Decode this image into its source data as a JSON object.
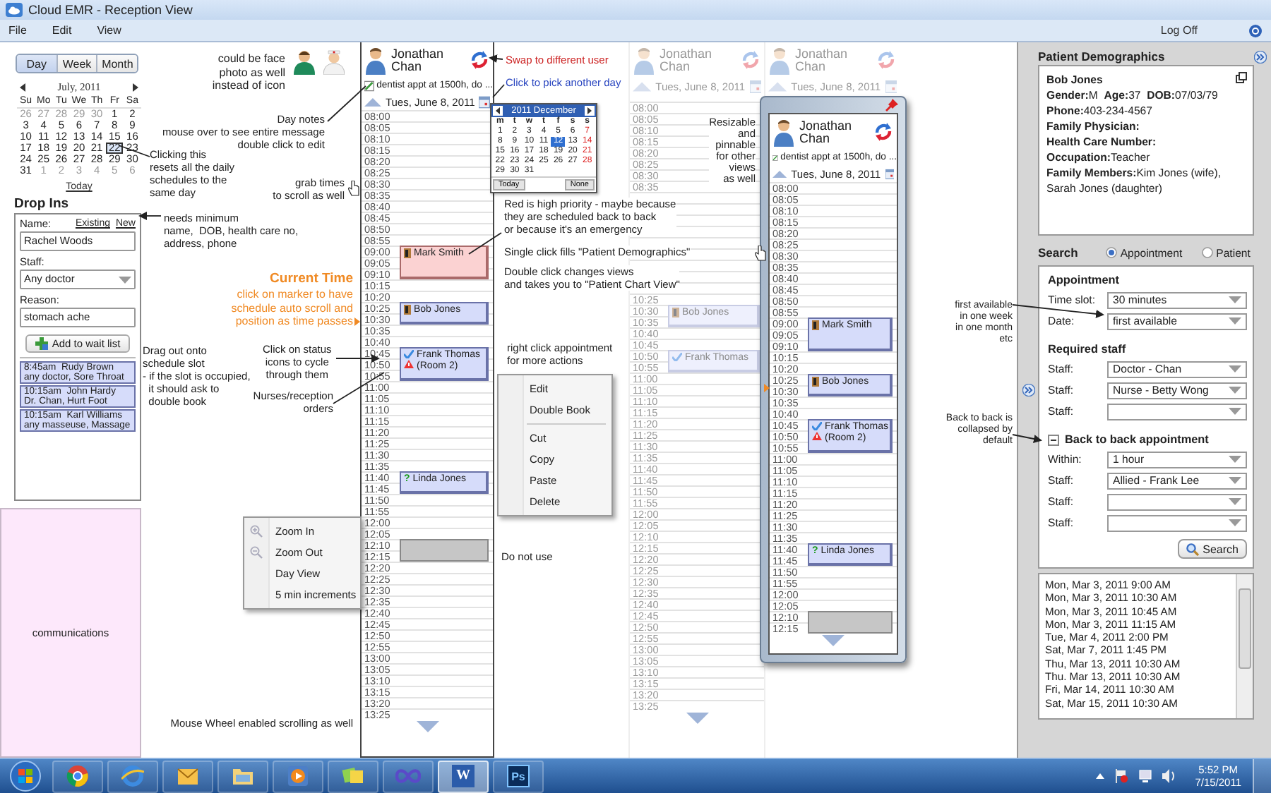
{
  "window": {
    "title": "Cloud EMR - Reception View"
  },
  "menu": [
    "File",
    "Edit",
    "View"
  ],
  "log_off": "Log Off",
  "view_switch": [
    {
      "label": "Day",
      "selected": true
    },
    {
      "label": "Week",
      "selected": false
    },
    {
      "label": "Month",
      "selected": false
    }
  ],
  "mini_calendar": {
    "title": "July, 2011",
    "weekdays": [
      "Su",
      "Mo",
      "Tu",
      "We",
      "Th",
      "Fr",
      "Sa"
    ],
    "weeks": [
      [
        {
          "day": "26",
          "outside": true,
          "selected": false
        },
        {
          "day": "27",
          "outside": true,
          "selected": false
        },
        {
          "day": "28",
          "outside": true,
          "selected": false
        },
        {
          "day": "29",
          "outside": true,
          "selected": false
        },
        {
          "day": "30",
          "outside": true,
          "selected": false
        },
        {
          "day": "1",
          "outside": false,
          "selected": false
        },
        {
          "day": "2",
          "outside": false,
          "selected": false
        }
      ],
      [
        {
          "day": "3",
          "outside": false,
          "selected": false
        },
        {
          "day": "4",
          "outside": false,
          "selected": false
        },
        {
          "day": "5",
          "outside": false,
          "selected": false
        },
        {
          "day": "6",
          "outside": false,
          "selected": false
        },
        {
          "day": "7",
          "outside": false,
          "selected": false
        },
        {
          "day": "8",
          "outside": false,
          "selected": false
        },
        {
          "day": "9",
          "outside": false,
          "selected": false
        }
      ],
      [
        {
          "day": "10",
          "outside": false,
          "selected": false
        },
        {
          "day": "11",
          "outside": false,
          "selected": false
        },
        {
          "day": "12",
          "outside": false,
          "selected": false
        },
        {
          "day": "13",
          "outside": false,
          "selected": false
        },
        {
          "day": "14",
          "outside": false,
          "selected": false
        },
        {
          "day": "15",
          "outside": false,
          "selected": false
        },
        {
          "day": "16",
          "outside": false,
          "selected": false
        }
      ],
      [
        {
          "day": "17",
          "outside": false,
          "selected": false
        },
        {
          "day": "18",
          "outside": false,
          "selected": false
        },
        {
          "day": "19",
          "outside": false,
          "selected": false
        },
        {
          "day": "20",
          "outside": false,
          "selected": false
        },
        {
          "day": "21",
          "outside": false,
          "selected": false
        },
        {
          "day": "22",
          "outside": false,
          "selected": true
        },
        {
          "day": "23",
          "outside": false,
          "selected": false
        }
      ],
      [
        {
          "day": "24",
          "outside": false,
          "selected": false
        },
        {
          "day": "25",
          "outside": false,
          "selected": false
        },
        {
          "day": "26",
          "outside": false,
          "selected": false
        },
        {
          "day": "27",
          "outside": false,
          "selected": false
        },
        {
          "day": "28",
          "outside": false,
          "selected": false
        },
        {
          "day": "29",
          "outside": false,
          "selected": false
        },
        {
          "day": "30",
          "outside": false,
          "selected": false
        }
      ],
      [
        {
          "day": "31",
          "outside": false,
          "selected": false
        },
        {
          "day": "1",
          "outside": true,
          "selected": false
        },
        {
          "day": "2",
          "outside": true,
          "selected": false
        },
        {
          "day": "3",
          "outside": true,
          "selected": false
        },
        {
          "day": "4",
          "outside": true,
          "selected": false
        },
        {
          "day": "5",
          "outside": true,
          "selected": false
        },
        {
          "day": "6",
          "outside": true,
          "selected": false
        }
      ]
    ],
    "today_link": "Today"
  },
  "drop_ins": {
    "title": "Drop Ins",
    "name_label": "Name:",
    "links": [
      "Existing",
      "New"
    ],
    "name_value": "Rachel Woods",
    "staff_label": "Staff:",
    "staff_value": "Any doctor",
    "reason_label": "Reason:",
    "reason_value": "stomach ache",
    "add_button": "Add to wait list",
    "waiting": [
      {
        "time": "8:45am",
        "name": "Rudy Brown",
        "detail": "any doctor, Sore Throat"
      },
      {
        "time": "10:15am",
        "name": "John Hardy",
        "detail": "Dr. Chan, Hurt Foot"
      },
      {
        "time": "10:15am",
        "name": "Karl Williams",
        "detail": "any masseuse, Massage"
      }
    ]
  },
  "communications": "communications",
  "schedule": {
    "columns": [
      {
        "faded": false,
        "user": "Jonathan Chan",
        "note": "dentist appt at 1500h, do ...",
        "date": "Tues, June 8, 2011",
        "slots": [
          "08:00",
          "08:05",
          "08:10",
          "08:15",
          "08:20",
          "08:25",
          "08:30",
          "08:35",
          "08:40",
          "08:45",
          "08:50",
          "08:55",
          {
            "times": [
              "09:00",
              "09:05",
              "09:10"
            ],
            "appointment": {
              "name": "Mark Smith",
              "kind": "high",
              "status": [
                {
                  "kind": "chart"
                }
              ]
            }
          },
          "10:15",
          "10:20",
          {
            "times": [
              "10:25",
              "10:30"
            ],
            "appointment": {
              "name": "Bob Jones",
              "kind": "normal",
              "status": [
                {
                  "kind": "chart"
                }
              ]
            }
          },
          "10:35",
          "10:40",
          {
            "times": [
              "10:45",
              "10:50",
              "10:55"
            ],
            "appointment": {
              "name": "Frank Thomas",
              "note": "(Room 2)",
              "kind": "normal",
              "status": [
                {
                  "kind": "check"
                },
                {
                  "kind": "warning"
                }
              ]
            }
          },
          "11:00",
          "11:05",
          "11:10",
          "11:15",
          "11:20",
          "11:25",
          "11:30",
          "11:35",
          {
            "times": [
              "11:40",
              "11:45"
            ],
            "appointment": {
              "name": "Linda Jones",
              "kind": "normal",
              "status": [
                {
                  "kind": "glyph",
                  "text": "?"
                }
              ]
            }
          },
          "11:50",
          "11:55",
          "12:00",
          "12:05",
          {
            "times": [
              "12:10",
              "12:15"
            ],
            "appointment": {
              "kind": "blocked"
            }
          },
          "12:20",
          "12:25",
          "12:30",
          "12:35",
          "12:40",
          "12:45",
          "12:50",
          "12:55",
          "13:00",
          "13:05",
          "13:10",
          "13:15",
          "13:20",
          "13:25"
        ]
      },
      {
        "faded": true,
        "user": "Jonathan Chan",
        "date": "Tues, June 8, 2011",
        "slots": [
          "08:00",
          "08:05",
          "08:10",
          "08:15",
          "08:20",
          "08:25",
          "08:30",
          "08:35",
          {
            "kind": "blank"
          },
          {
            "kind": "blank"
          },
          {
            "kind": "blank"
          },
          {
            "kind": "blank"
          },
          {
            "kind": "blank"
          },
          {
            "kind": "blank"
          },
          {
            "kind": "blank"
          },
          {
            "kind": "blank"
          },
          {
            "kind": "blank"
          },
          "10:25",
          {
            "times": [
              "10:30",
              "10:35"
            ],
            "appointment": {
              "name": "Bob Jones",
              "kind": "normal",
              "status": [
                {
                  "kind": "chart"
                }
              ]
            }
          },
          "10:40",
          "10:45",
          {
            "times": [
              "10:50",
              "10:55"
            ],
            "appointment": {
              "name": "Frank Thomas",
              "kind": "normal",
              "status": [
                {
                  "kind": "check"
                }
              ]
            }
          },
          "11:00",
          "11:05",
          "11:10",
          "11:15",
          "11:20",
          "11:25",
          "11:30",
          "11:35",
          "11:40",
          "11:45",
          "11:50",
          "11:55",
          "12:00",
          "12:05",
          "12:10",
          "12:15",
          "12:20",
          "12:25",
          "12:30",
          "12:35",
          "12:40",
          "12:45",
          "12:50",
          "12:55",
          "13:00",
          "13:05",
          "13:10",
          "13:15",
          "13:20",
          "13:25"
        ]
      },
      {
        "faded": true,
        "user": "Jonathan Chan",
        "date": "Tues, June 8, 2011"
      }
    ]
  },
  "floating_window": {
    "column": {
      "faded": false,
      "user": "Jonathan Chan",
      "note": "dentist appt at 1500h, do ...",
      "date": "Tues, June 8, 2011",
      "slots": [
        "08:00",
        "08:05",
        "08:10",
        "08:15",
        "08:20",
        "08:25",
        "08:30",
        "08:35",
        "08:40",
        "08:45",
        "08:50",
        "08:55",
        {
          "times": [
            "09:00",
            "09:05",
            "09:10"
          ],
          "appointment": {
            "name": "Mark Smith",
            "kind": "normal",
            "status": [
              {
                "kind": "chart"
              }
            ]
          }
        },
        "10:15",
        "10:20",
        {
          "times": [
            "10:25",
            "10:30"
          ],
          "appointment": {
            "name": "Bob Jones",
            "kind": "normal",
            "status": [
              {
                "kind": "chart"
              }
            ]
          }
        },
        "10:35",
        "10:40",
        {
          "times": [
            "10:45",
            "10:50",
            "10:55"
          ],
          "appointment": {
            "name": "Frank Thomas",
            "note": "(Room 2)",
            "kind": "normal",
            "status": [
              {
                "kind": "check"
              },
              {
                "kind": "warning"
              }
            ]
          }
        },
        "11:00",
        "11:05",
        "11:10",
        "11:15",
        "11:20",
        "11:25",
        "11:30",
        "11:35",
        {
          "times": [
            "11:40",
            "11:45"
          ],
          "appointment": {
            "name": "Linda Jones",
            "kind": "normal",
            "status": [
              {
                "kind": "glyph",
                "text": "?"
              }
            ]
          }
        },
        "11:50",
        "11:55",
        "12:00",
        "12:05",
        {
          "times": [
            "12:10",
            "12:15"
          ],
          "appointment": {
            "kind": "blocked"
          }
        }
      ]
    }
  },
  "day_picker": {
    "title": "2011 December",
    "weekdays": [
      "m",
      "t",
      "w",
      "t",
      "f",
      "s",
      "s"
    ],
    "days": [
      {
        "day": "1",
        "selected": false
      },
      {
        "day": "2",
        "selected": false
      },
      {
        "day": "3",
        "selected": false
      },
      {
        "day": "4",
        "selected": false
      },
      {
        "day": "5",
        "selected": false
      },
      {
        "day": "6",
        "selected": false
      },
      {
        "day": "7",
        "selected": false
      },
      {
        "day": "8",
        "selected": false
      },
      {
        "day": "9",
        "selected": false
      },
      {
        "day": "10",
        "selected": false
      },
      {
        "day": "11",
        "selected": false
      },
      {
        "day": "12",
        "selected": true
      },
      {
        "day": "13",
        "selected": false
      },
      {
        "day": "14",
        "selected": false
      },
      {
        "day": "15",
        "selected": false
      },
      {
        "day": "16",
        "selected": false
      },
      {
        "day": "17",
        "selected": false
      },
      {
        "day": "18",
        "selected": false
      },
      {
        "day": "19",
        "selected": false
      },
      {
        "day": "20",
        "selected": false
      },
      {
        "day": "21",
        "selected": false
      },
      {
        "day": "22",
        "selected": false
      },
      {
        "day": "23",
        "selected": false
      },
      {
        "day": "24",
        "selected": false
      },
      {
        "day": "25",
        "selected": false
      },
      {
        "day": "26",
        "selected": false
      },
      {
        "day": "27",
        "selected": false
      },
      {
        "day": "28",
        "selected": false
      },
      {
        "day": "29",
        "selected": false
      },
      {
        "day": "30",
        "selected": false
      },
      {
        "day": "31",
        "selected": false
      }
    ],
    "buttons": [
      "Today",
      "None"
    ]
  },
  "appointment_menu": [
    {
      "kind": "item",
      "label": "Edit"
    },
    {
      "kind": "item",
      "label": "Double Book"
    },
    {
      "kind": "separator"
    },
    {
      "kind": "item",
      "label": "Cut"
    },
    {
      "kind": "item",
      "label": "Copy"
    },
    {
      "kind": "item",
      "label": "Paste"
    },
    {
      "kind": "item",
      "label": "Delete"
    }
  ],
  "view_menu": [
    {
      "kind": "zoom-in",
      "label": "Zoom In"
    },
    {
      "kind": "zoom-out",
      "label": "Zoom Out"
    },
    {
      "kind": "item",
      "label": "Day View"
    },
    {
      "kind": "item",
      "label": "5 min increments"
    }
  ],
  "annotations": [
    {
      "kind": "note",
      "text": "could be face\nphoto as well\ninstead of icon"
    },
    {
      "kind": "alert",
      "text": "Swap to different user"
    },
    {
      "kind": "hint",
      "text": "Click to pick another day"
    },
    {
      "kind": "note",
      "text": "Day notes\nmouse over to see entire message\ndouble click to edit"
    },
    {
      "kind": "note",
      "text": "Resizable\nand\npinnable\nfor other\nviews\nas well"
    },
    {
      "kind": "note",
      "text": "Clicking this\nresets all the daily\nschedules to the\nsame day"
    },
    {
      "kind": "note",
      "text": "grab times\nto scroll as well"
    },
    {
      "kind": "note",
      "text": "Red is high priority - maybe because\nthey are scheduled back to back\nor because it's an emergency"
    },
    {
      "kind": "note",
      "text": "needs minimum\nname,  DOB, health care no,\naddress, phone"
    },
    {
      "kind": "note",
      "text": "Single click fills \"Patient Demographics\""
    },
    {
      "kind": "current",
      "title": "Current Time",
      "text": "click on marker to have\nschedule auto scroll and\nposition as time passes"
    },
    {
      "kind": "note",
      "text": "Double click changes views\nand takes you to \"Patient Chart View\""
    },
    {
      "kind": "note",
      "text": "first available\nin one week\nin one month\netc"
    },
    {
      "kind": "note",
      "text": "Drag out onto\nschedule slot\n- if the slot is occupied,\n  it should ask to\n  double book"
    },
    {
      "kind": "note",
      "text": "Click on status\nicons to cycle\nthrough them"
    },
    {
      "kind": "note",
      "text": "right click appointment\nfor more actions"
    },
    {
      "kind": "note",
      "text": "Nurses/reception\norders"
    },
    {
      "kind": "note",
      "text": "Back to back is\ncollapsed by\ndefault"
    },
    {
      "kind": "note",
      "text": "Do not use"
    },
    {
      "kind": "note",
      "text": "Mouse Wheel enabled scrolling as well"
    }
  ],
  "patient_demographics": {
    "title": "Patient Demographics",
    "name": "Bob Jones",
    "lines": [
      [
        {
          "label": "Gender:",
          "value": "M"
        },
        {
          "label": "Age:",
          "value": "37"
        },
        {
          "label": "DOB:",
          "value": "07/03/79"
        }
      ],
      [
        {
          "label": "Phone:",
          "value": "403-234-4567"
        }
      ],
      [
        {
          "label": "Family Physician:"
        }
      ],
      [
        {
          "label": "Health Care Number:"
        }
      ],
      [
        {
          "label": "Occupation:",
          "value": "Teacher"
        }
      ],
      [
        {
          "label": "Family Members:",
          "value": "Kim Jones (wife), Sarah Jones (daughter)"
        }
      ]
    ]
  },
  "search": {
    "title": "Search",
    "modes": [
      {
        "label": "Appointment",
        "selected": true
      },
      {
        "label": "Patient",
        "selected": false
      }
    ],
    "appointment": {
      "heading": "Appointment",
      "fields": [
        {
          "label": "Time slot:",
          "value": "30 minutes"
        },
        {
          "label": "Date:",
          "value": "first available"
        }
      ]
    },
    "required_staff": {
      "heading": "Required staff",
      "fields": [
        {
          "label": "Staff:",
          "value": "Doctor - Chan"
        },
        {
          "label": "Staff:",
          "value": "Nurse - Betty Wong"
        },
        {
          "label": "Staff:"
        }
      ]
    },
    "back_to_back": {
      "heading": "Back to back appointment",
      "expanded": true,
      "fields": [
        {
          "label": "Within:",
          "value": "1 hour"
        },
        {
          "label": "Staff:",
          "value": "Allied - Frank Lee"
        },
        {
          "label": "Staff:"
        },
        {
          "label": "Staff:"
        }
      ]
    },
    "button": "Search",
    "results": [
      "Mon, Mar 3, 2011 9:00 AM",
      "Mon, Mar 3, 2011 10:30 AM",
      "Mon, Mar 3, 2011 10:45 AM",
      "Mon, Mar 3, 2011 11:15 AM",
      "Tue, Mar 4, 2011 2:00 PM",
      "Sat, Mar 7, 2011 1:45 PM",
      "Thu, Mar 13, 2011 10:30 AM",
      "Thu. Mar 13, 2011 10:30 AM",
      "Fri, Mar 14, 2011 10:30 AM",
      "Sat, Mar 15, 2011 10:30 AM"
    ]
  },
  "taskbar": {
    "apps": [
      {
        "kind": "browser",
        "active": false
      },
      {
        "kind": "globe",
        "active": false
      },
      {
        "kind": "notes",
        "active": false
      },
      {
        "kind": "folder",
        "active": false
      },
      {
        "kind": "media",
        "active": false
      },
      {
        "kind": "tiles",
        "active": false
      },
      {
        "kind": "infinity",
        "active": false
      },
      {
        "kind": "word",
        "label": "W",
        "active": true
      },
      {
        "kind": "ps",
        "label": "Ps",
        "active": false
      }
    ],
    "clock": {
      "time": "5:52 PM",
      "date": "7/15/2011"
    }
  }
}
